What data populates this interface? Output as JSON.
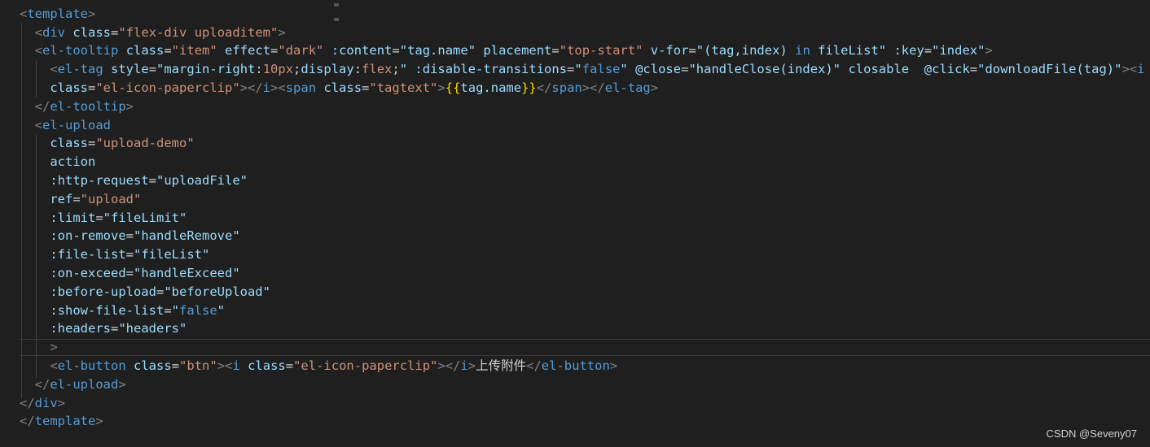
{
  "code": {
    "l1_open": "<",
    "l1_tag": "template",
    "l1_close": ">",
    "l2_open": "<",
    "l2_tag": "div",
    "l2_attr": "class",
    "l2_eq": "=",
    "l2_val": "\"flex-div uploaditem\"",
    "l2_close": ">",
    "l3_open": "<",
    "l3_tag": "el-tooltip",
    "l3_a1": "class",
    "l3_v1": "\"item\"",
    "l3_a2": "effect",
    "l3_v2": "\"dark\"",
    "l3_a3": ":content",
    "l3_v3": "\"tag.name\"",
    "l3_a4": "placement",
    "l3_v4": "\"top-start\"",
    "l3_a5": "v-for",
    "l3_v5_q1": "\"",
    "l3_v5_expr1": "(tag,index)",
    "l3_v5_in": "in",
    "l3_v5_expr2": "fileList",
    "l3_v5_q2": "\"",
    "l3_a6": ":key",
    "l3_v6": "\"index\"",
    "l3_close": ">",
    "l4_open": "<",
    "l4_tag": "el-tag",
    "l4_a1": "style",
    "l4_v1_q1": "\"",
    "l4_v1_p1": "margin-right",
    "l4_v1_c1": ":",
    "l4_v1_n1": "10px",
    "l4_v1_s1": ";",
    "l4_v1_p2": "display",
    "l4_v1_c2": ":",
    "l4_v1_n2": "flex",
    "l4_v1_s2": ";",
    "l4_v1_q2": "\"",
    "l4_a2": ":disable-transitions",
    "l4_v2_q1": "\"",
    "l4_v2_val": "false",
    "l4_v2_q2": "\"",
    "l4_a3": "@close",
    "l4_v3_q1": "\"",
    "l4_v3_val": "handleClose(index)",
    "l4_v3_q2": "\"",
    "l4_a4": "closable",
    "l4_a5": "@click",
    "l4_v5_q1": "\"",
    "l4_v5_val": "downloadFile(tag)",
    "l4_v5_q2": "\"",
    "l4_gt": ">",
    "l4_lt": "<",
    "l4_itag": "i",
    "l5_attr": "class",
    "l5_val": "\"el-icon-paperclip\"",
    "l5_gt1": ">",
    "l5_lt1": "</",
    "l5_itag": "i",
    "l5_gt2": ">",
    "l5_lt2": "<",
    "l5_span": "span",
    "l5_sattr": "class",
    "l5_sval": "\"tagtext\"",
    "l5_gt3": ">",
    "l5_mopen": "{{",
    "l5_mexpr": "tag.name",
    "l5_mclose": "}}",
    "l5_lt3": "</",
    "l5_span2": "span",
    "l5_gt4": ">",
    "l5_lt4": "</",
    "l5_eltag": "el-tag",
    "l5_gt5": ">",
    "l6_open": "</",
    "l6_tag": "el-tooltip",
    "l6_close": ">",
    "l7_open": "<",
    "l7_tag": "el-upload",
    "l8_attr": "class",
    "l8_val": "\"upload-demo\"",
    "l9_attr": "action",
    "l10_attr": ":http-request",
    "l10_val": "\"uploadFile\"",
    "l11_attr": "ref",
    "l11_val": "\"upload\"",
    "l12_attr": ":limit",
    "l12_val": "\"fileLimit\"",
    "l13_attr": ":on-remove",
    "l13_val": "\"handleRemove\"",
    "l14_attr": ":file-list",
    "l14_val": "\"fileList\"",
    "l15_attr": ":on-exceed",
    "l15_val": "\"handleExceed\"",
    "l16_attr": ":before-upload",
    "l16_val": "\"beforeUpload\"",
    "l17_attr": ":show-file-list",
    "l17_q1": "\"",
    "l17_val": "false",
    "l17_q2": "\"",
    "l18_attr": ":headers",
    "l18_val": "\"headers\"",
    "l19_close": ">",
    "l20_open": "<",
    "l20_tag": "el-button",
    "l20_attr": "class",
    "l20_val": "\"btn\"",
    "l20_gt1": ">",
    "l20_lt1": "<",
    "l20_itag": "i",
    "l20_iattr": "class",
    "l20_ival": "\"el-icon-paperclip\"",
    "l20_gt2": ">",
    "l20_lt2": "</",
    "l20_itag2": "i",
    "l20_gt3": ">",
    "l20_text": "上传附件",
    "l20_lt3": "</",
    "l20_btag": "el-button",
    "l20_gt4": ">",
    "l21_open": "</",
    "l21_tag": "el-upload",
    "l21_close": ">",
    "l22_open": "</",
    "l22_tag": "div",
    "l22_close": ">",
    "l23_open": "</",
    "l23_tag": "template",
    "l23_close": ">"
  },
  "watermark": "CSDN @Seveny07",
  "colors": {
    "background": "#1f1f1f",
    "tag": "#569cd6",
    "attribute": "#9cdcfe",
    "string": "#ce9178",
    "punctuation": "#808080",
    "mustache": "#ffd700"
  }
}
